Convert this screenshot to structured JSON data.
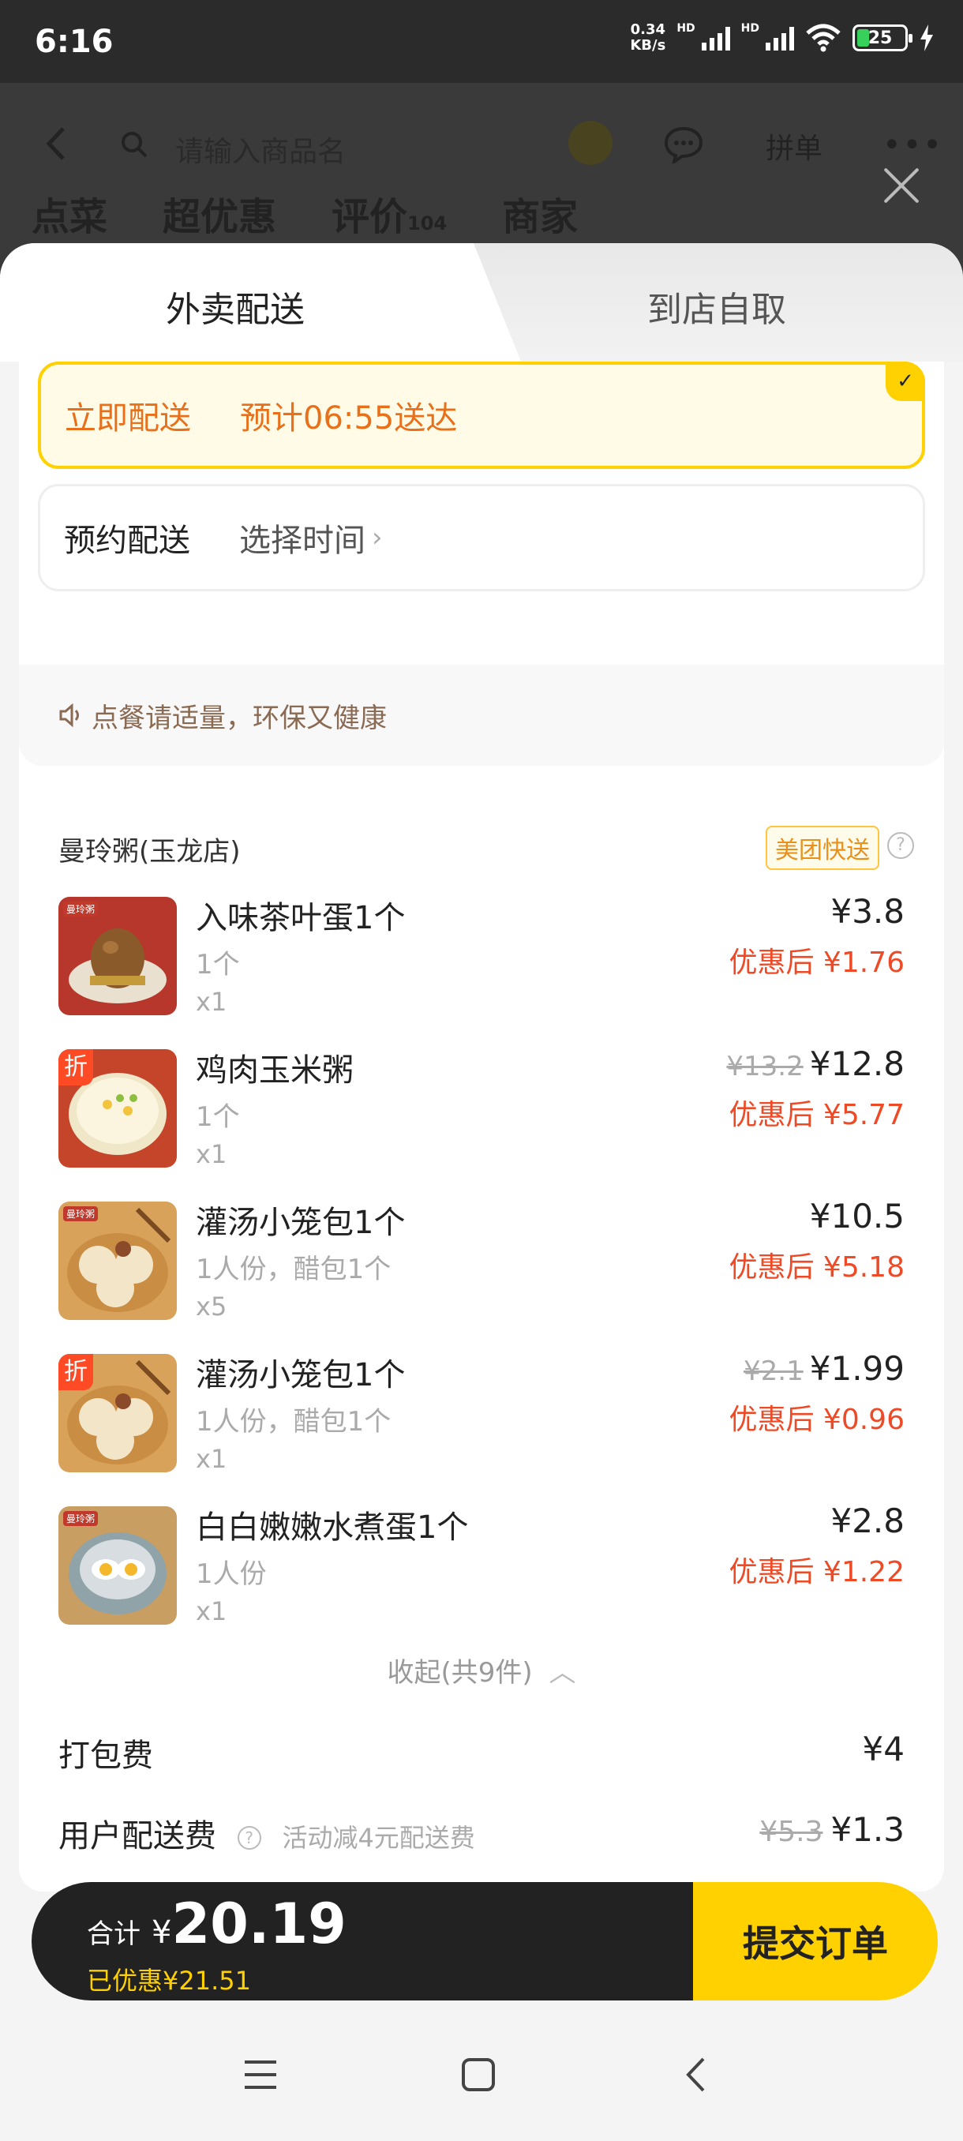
{
  "status_bar": {
    "time": "6:16",
    "net_speed_value": "0.34",
    "net_speed_unit": "KB/s",
    "hd1": "HD",
    "hd2": "HD",
    "battery": "25",
    "icons": [
      "signal-icon",
      "signal-icon",
      "wifi-icon",
      "battery-icon",
      "charging-icon"
    ]
  },
  "background": {
    "search_placeholder": "请输入商品名",
    "pin_label": "拼单",
    "tabs": [
      "点菜",
      "超优惠",
      "评价",
      "商家"
    ],
    "review_count": "104"
  },
  "delivery_tabs": {
    "active": "外卖配送",
    "inactive": "到店自取"
  },
  "delivery_options": {
    "now_label": "立即配送",
    "now_eta": "预计06:55送达",
    "schedule_label": "预约配送",
    "schedule_value": "选择时间"
  },
  "notice": "点餐请适量，环保又健康",
  "order": {
    "shop_name": "曼玲粥(玉龙店)",
    "delivery_badge": "美团快送",
    "items": [
      {
        "name": "入味茶叶蛋1个",
        "spec": "1个",
        "qty": "x1",
        "price": "¥3.8",
        "original": "",
        "discount": "优惠后 ¥1.76",
        "tag": ""
      },
      {
        "name": "鸡肉玉米粥",
        "spec": "1个",
        "qty": "x1",
        "price": "¥12.8",
        "original": "¥13.2",
        "discount": "优惠后 ¥5.77",
        "tag": "折"
      },
      {
        "name": "灌汤小笼包1个",
        "spec": "1人份，醋包1个",
        "qty": "x5",
        "price": "¥10.5",
        "original": "",
        "discount": "优惠后 ¥5.18",
        "tag": ""
      },
      {
        "name": "灌汤小笼包1个",
        "spec": "1人份，醋包1个",
        "qty": "x1",
        "price": "¥1.99",
        "original": "¥2.1",
        "discount": "优惠后 ¥0.96",
        "tag": "折"
      },
      {
        "name": "白白嫩嫩水煮蛋1个",
        "spec": "1人份",
        "qty": "x1",
        "price": "¥2.8",
        "original": "",
        "discount": "优惠后 ¥1.22",
        "tag": ""
      }
    ],
    "collapse_label": "收起(共9件)",
    "packing_fee_label": "打包费",
    "packing_fee": "¥4",
    "delivery_fee_label": "用户配送费",
    "delivery_fee_note": "活动减4元配送费",
    "delivery_fee_original": "¥5.3",
    "delivery_fee": "¥1.3"
  },
  "checkout": {
    "total_label": "合计",
    "currency": "¥",
    "total": "20.19",
    "saved": "已优惠¥21.51",
    "submit": "提交订单"
  },
  "colors": {
    "accent_yellow": "#ffd100",
    "discount_red": "#ee4a26",
    "eta_orange": "#e8701a"
  }
}
